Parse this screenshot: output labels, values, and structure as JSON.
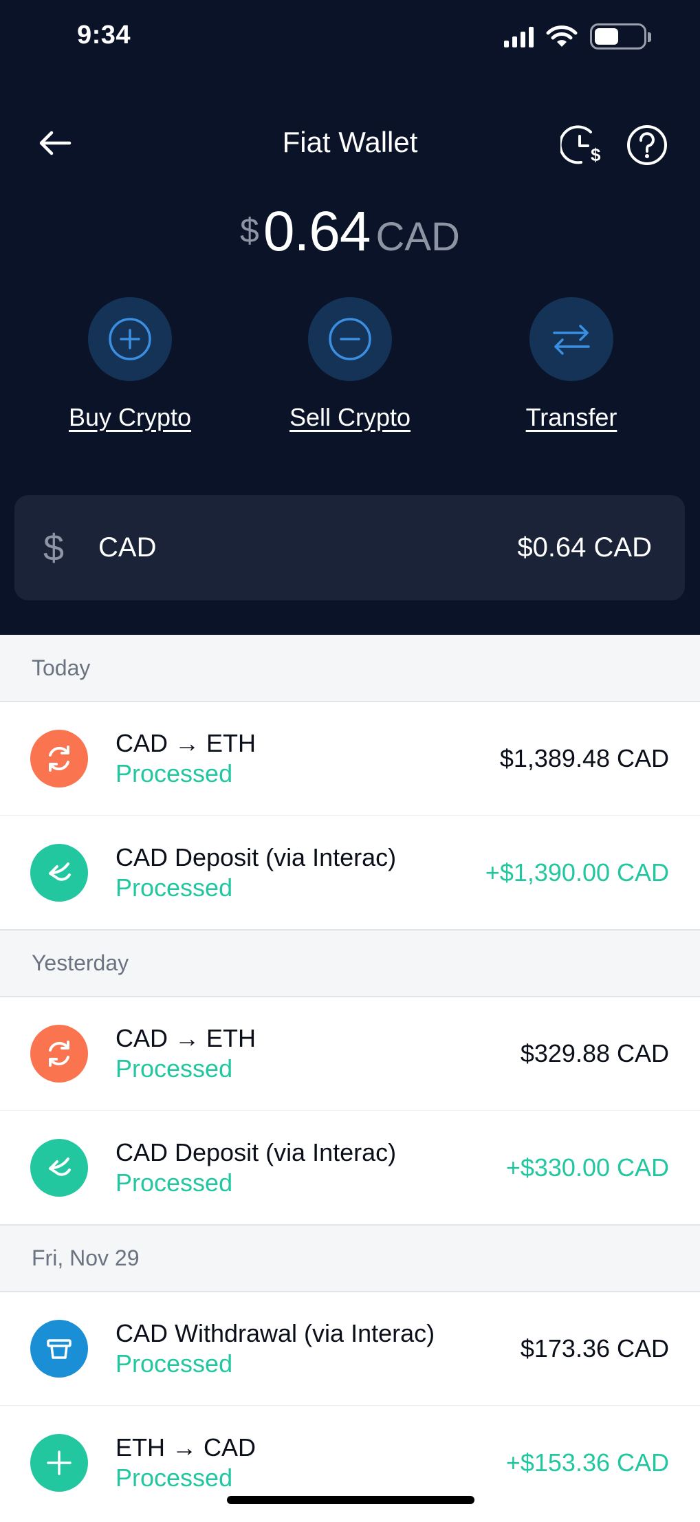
{
  "status_bar": {
    "time": "9:34"
  },
  "nav": {
    "title": "Fiat Wallet"
  },
  "balance": {
    "symbol": "$",
    "amount": "0.64",
    "currency": "CAD"
  },
  "actions": [
    {
      "label": "Buy Crypto",
      "icon": "plus-circle-icon"
    },
    {
      "label": "Sell Crypto",
      "icon": "minus-circle-icon"
    },
    {
      "label": "Transfer",
      "icon": "transfer-arrows-icon"
    }
  ],
  "wallet": {
    "symbol": "$",
    "code": "CAD",
    "value": "$0.64 CAD"
  },
  "sections": [
    {
      "label": "Today",
      "items": [
        {
          "title": "CAD → ETH",
          "status": "Processed",
          "amount": "$1,389.48 CAD",
          "icon": "swap-icon",
          "color": "#fa7450"
        },
        {
          "title": "CAD Deposit (via Interac)",
          "status": "Processed",
          "amount": "+$1,390.00 CAD",
          "icon": "deposit-icon",
          "color": "#22c7a0"
        }
      ]
    },
    {
      "label": "Yesterday",
      "items": [
        {
          "title": "CAD → ETH",
          "status": "Processed",
          "amount": "$329.88 CAD",
          "icon": "swap-icon",
          "color": "#fa7450"
        },
        {
          "title": "CAD Deposit (via Interac)",
          "status": "Processed",
          "amount": "+$330.00 CAD",
          "icon": "deposit-icon",
          "color": "#22c7a0"
        }
      ]
    },
    {
      "label": "Fri, Nov 29",
      "items": [
        {
          "title": "CAD Withdrawal (via Interac)",
          "status": "Processed",
          "amount": "$173.36 CAD",
          "icon": "withdrawal-icon",
          "color": "#1a8fd6"
        },
        {
          "title": "ETH → CAD",
          "status": "Processed",
          "amount": "+$153.36 CAD",
          "icon": "plus-icon",
          "color": "#22c7a0"
        }
      ]
    }
  ],
  "colors": {
    "header_bg": "#0b1328",
    "action_circle": "#143356",
    "accent_blue": "#3b8fe0",
    "positive": "#22c7a0"
  }
}
